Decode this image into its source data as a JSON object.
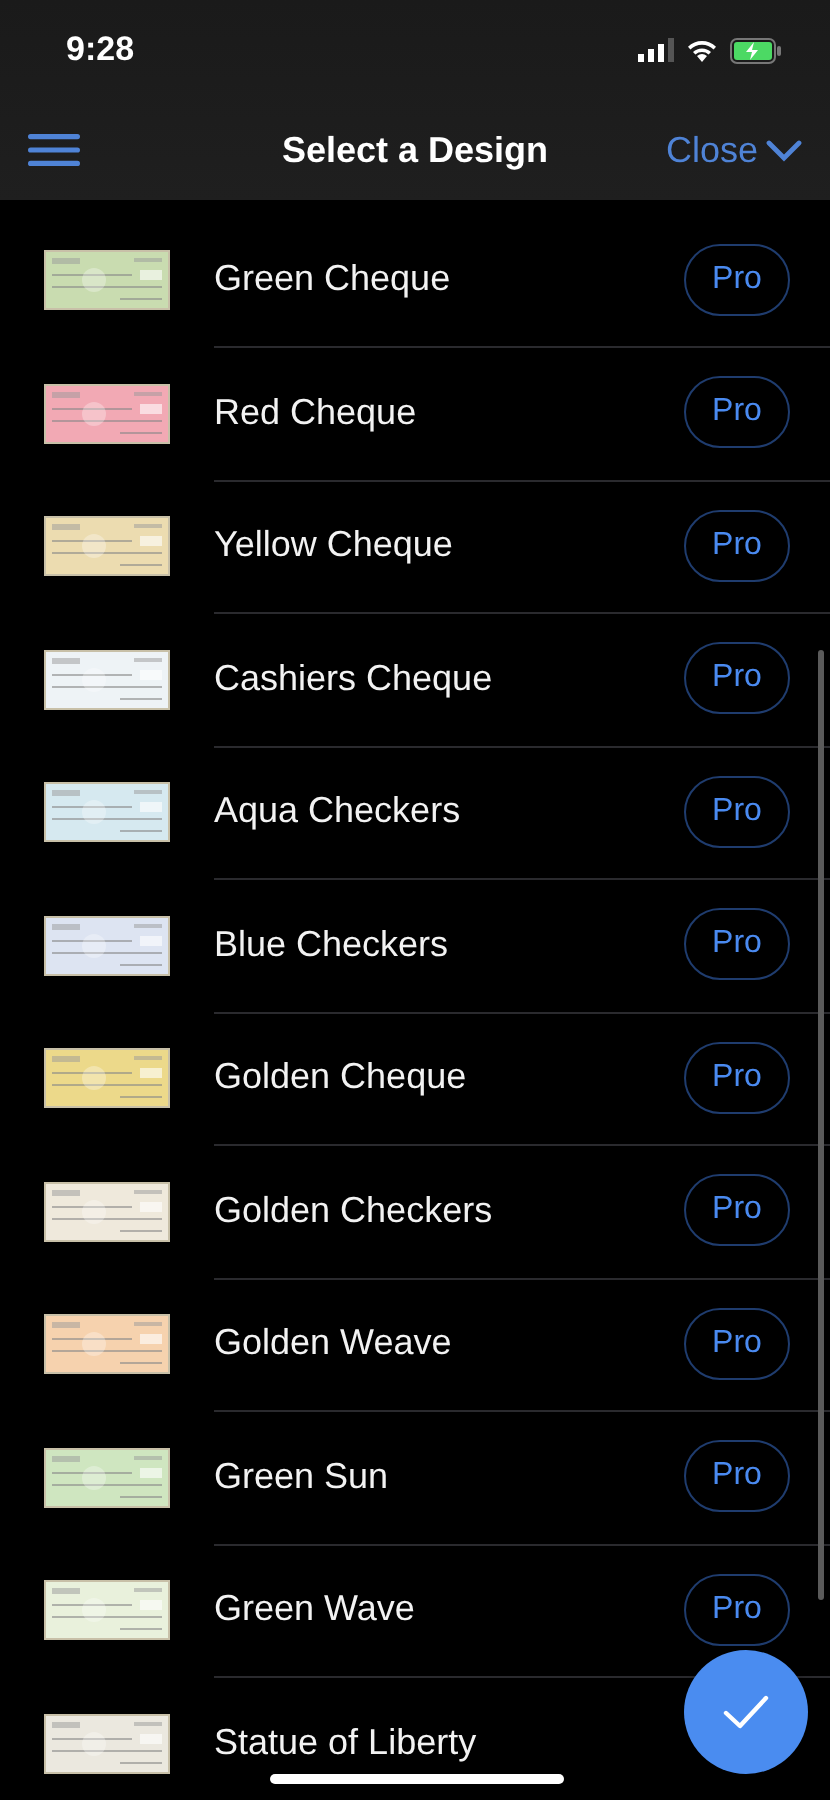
{
  "status_bar": {
    "time": "9:28"
  },
  "nav_bar": {
    "title": "Select a Design",
    "close": "Close"
  },
  "designs": [
    {
      "name": "Green Cheque",
      "color": "#c9dcb0",
      "badge": "Pro"
    },
    {
      "name": "Red Cheque",
      "color": "#f2a9b4",
      "badge": "Pro"
    },
    {
      "name": "Yellow Cheque",
      "color": "#ecdcb0",
      "badge": "Pro"
    },
    {
      "name": "Cashiers Cheque",
      "color": "#eef3f6",
      "badge": "Pro"
    },
    {
      "name": "Aqua Checkers",
      "color": "#d6e9f0",
      "badge": "Pro"
    },
    {
      "name": "Blue Checkers",
      "color": "#dde4f2",
      "badge": "Pro"
    },
    {
      "name": "Golden Cheque",
      "color": "#ecd98a",
      "badge": "Pro"
    },
    {
      "name": "Golden Checkers",
      "color": "#efe9dc",
      "badge": "Pro"
    },
    {
      "name": "Golden Weave",
      "color": "#f6d2ae",
      "badge": "Pro"
    },
    {
      "name": "Green Sun",
      "color": "#cfe6c0",
      "badge": "Pro"
    },
    {
      "name": "Green Wave",
      "color": "#e9f1dc",
      "badge": "Pro"
    },
    {
      "name": "Statue of Liberty",
      "color": "#ebe8df"
    }
  ]
}
